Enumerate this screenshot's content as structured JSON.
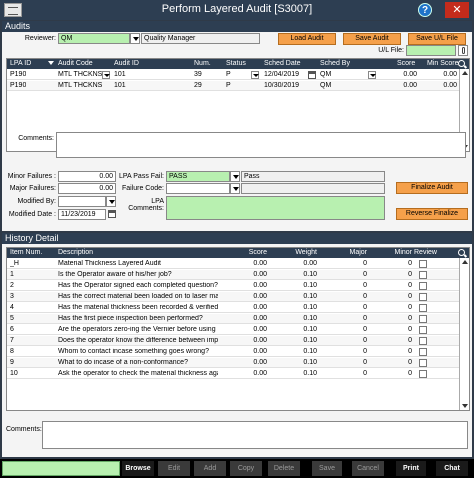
{
  "window": {
    "title": "Perform Layered Audit [S3007]",
    "help_label": "?",
    "close_label": "✕"
  },
  "audits_section": {
    "title": "Audits",
    "reviewer_label": "Reviewer:",
    "reviewer_code": "QM",
    "reviewer_name": "Quality Manager",
    "load_audit": "Load Audit",
    "save_audit": "Save Audit",
    "save_ul_file": "Save U/L File",
    "ul_file_label": "U/L File:",
    "ul_file_value": "",
    "columns": [
      "LPA ID",
      "Audit Code",
      "Audit ID",
      "Num.",
      "Status",
      "Sched Date",
      "Sched By",
      "Score",
      "Min Score"
    ],
    "rows": [
      {
        "lpa_id": "P190",
        "audit_code": "MTL THCKNS",
        "audit_id": "101",
        "num": "39",
        "status": "P",
        "sched_date": "12/04/2019",
        "sched_by": "QM",
        "score": "0.00",
        "min_score": "0.00"
      },
      {
        "lpa_id": "P190",
        "audit_code": "MTL THCKNS",
        "audit_id": "101",
        "num": "29",
        "status": "P",
        "sched_date": "10/30/2019",
        "sched_by": "QM",
        "score": "0.00",
        "min_score": "0.00"
      }
    ],
    "comments_label": "Comments:",
    "comments_value": "",
    "minor_failures_label": "Minor Failures :",
    "minor_failures_value": "0.00",
    "major_failures_label": "Major Failures:",
    "major_failures_value": "0.00",
    "modified_by_label": "Modified By:",
    "modified_by_value": "",
    "modified_date_label": "Modified Date :",
    "modified_date_value": "11/23/2019",
    "lpa_pass_fail_label": "LPA Pass Fail:",
    "lpa_pass_fail_code": "PASS",
    "lpa_pass_fail_desc": "Pass",
    "failure_code_label": "Failure Code:",
    "failure_code_value": "",
    "lpa_comments_label": "LPA Comments:",
    "lpa_comments_value": "",
    "finalize_audit": "Finalize Audit",
    "reverse_finalize": "Reverse Finalize"
  },
  "history_section": {
    "title": "History Detail",
    "columns": [
      "Item Num.",
      "Description",
      "Score",
      "Weight",
      "Major",
      "Minor",
      "Review"
    ],
    "rows": [
      {
        "item": "_H",
        "description": "Material Thickness Layered Audit",
        "score": "0.00",
        "weight": "0.00",
        "major": "0",
        "minor": "0"
      },
      {
        "item": "1",
        "description": "Is the Operator aware of his/her job?",
        "score": "0.00",
        "weight": "0.10",
        "major": "0",
        "minor": "0"
      },
      {
        "item": "2",
        "description": "Has the Operator signed each completed question?",
        "score": "0.00",
        "weight": "0.10",
        "major": "0",
        "minor": "0"
      },
      {
        "item": "3",
        "description": "Has the correct material been loaded on to laser ma",
        "score": "0.00",
        "weight": "0.10",
        "major": "0",
        "minor": "0"
      },
      {
        "item": "4",
        "description": "Has the material thickness been recorded & verified?",
        "score": "0.00",
        "weight": "0.10",
        "major": "0",
        "minor": "0"
      },
      {
        "item": "5",
        "description": "Has the first piece inspection been performed?",
        "score": "0.00",
        "weight": "0.10",
        "major": "0",
        "minor": "0"
      },
      {
        "item": "6",
        "description": "Are the operators zero-ing the Vernier before using",
        "score": "0.00",
        "weight": "0.10",
        "major": "0",
        "minor": "0"
      },
      {
        "item": "7",
        "description": "Does the operator know the difference between imp",
        "score": "0.00",
        "weight": "0.10",
        "major": "0",
        "minor": "0"
      },
      {
        "item": "8",
        "description": "Whom to contact incase something goes wrong?",
        "score": "0.00",
        "weight": "0.10",
        "major": "0",
        "minor": "0"
      },
      {
        "item": "9",
        "description": "What to do incase of a non-conformance?",
        "score": "0.00",
        "weight": "0.10",
        "major": "0",
        "minor": "0"
      },
      {
        "item": "10",
        "description": "Ask the operator to check the material thickness aga",
        "score": "0.00",
        "weight": "0.10",
        "major": "0",
        "minor": "0"
      }
    ],
    "comments_label": "Comments:",
    "comments_value": ""
  },
  "toolbar": {
    "buttons": [
      "Browse",
      "Edit",
      "Add",
      "Copy",
      "Delete",
      "Save",
      "Cancel",
      "Print",
      "Chat"
    ]
  },
  "colors": {
    "header": "#2d3e52",
    "accent_green": "#b8f0b0",
    "accent_orange": "#f5a04a"
  }
}
